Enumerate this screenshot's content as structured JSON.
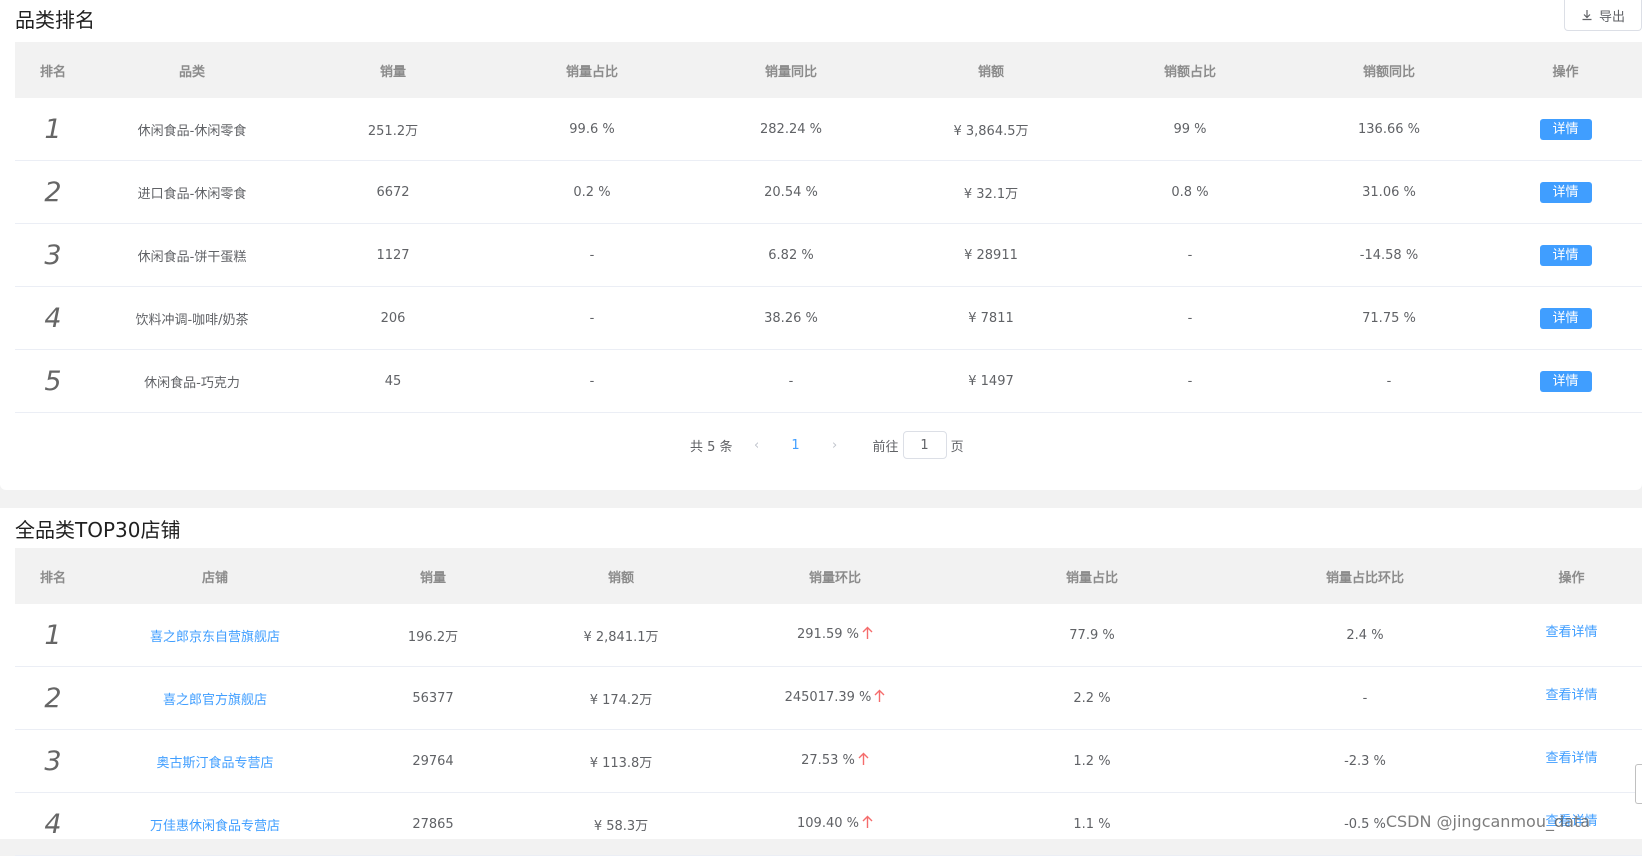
{
  "category_section": {
    "title": "品类排名",
    "export_label": "导出",
    "columns": [
      "排名",
      "品类",
      "销量",
      "销量占比",
      "销量同比",
      "销额",
      "销额占比",
      "销额同比",
      "操作"
    ],
    "detail_label": "详情",
    "rows": [
      {
        "rank": "1",
        "category": "休闲食品-休闲零食",
        "sales_qty": "251.2万",
        "qty_share": "99.6 %",
        "qty_yoy": "282.24 %",
        "amount": "¥ 3,864.5万",
        "amount_share": "99 %",
        "amount_yoy": "136.66 %"
      },
      {
        "rank": "2",
        "category": "进口食品-休闲零食",
        "sales_qty": "6672",
        "qty_share": "0.2 %",
        "qty_yoy": "20.54 %",
        "amount": "¥ 32.1万",
        "amount_share": "0.8 %",
        "amount_yoy": "31.06 %"
      },
      {
        "rank": "3",
        "category": "休闲食品-饼干蛋糕",
        "sales_qty": "1127",
        "qty_share": "-",
        "qty_yoy": "6.82 %",
        "amount": "¥ 28911",
        "amount_share": "-",
        "amount_yoy": "-14.58 %"
      },
      {
        "rank": "4",
        "category": "饮料冲调-咖啡/奶茶",
        "sales_qty": "206",
        "qty_share": "-",
        "qty_yoy": "38.26 %",
        "amount": "¥ 7811",
        "amount_share": "-",
        "amount_yoy": "71.75 %"
      },
      {
        "rank": "5",
        "category": "休闲食品-巧克力",
        "sales_qty": "45",
        "qty_share": "-",
        "qty_yoy": "-",
        "amount": "¥ 1497",
        "amount_share": "-",
        "amount_yoy": "-"
      }
    ],
    "pagination": {
      "total_text": "共 5 条",
      "current_page": "1",
      "goto_prefix": "前往",
      "goto_value": "1",
      "goto_suffix": "页"
    }
  },
  "store_section": {
    "title": "全品类TOP30店铺",
    "columns": [
      "排名",
      "店铺",
      "销量",
      "销额",
      "销量环比",
      "销量占比",
      "销量占比环比",
      "操作"
    ],
    "view_detail_label": "查看详情",
    "rows": [
      {
        "rank": "1",
        "store": "喜之郎京东自营旗舰店",
        "sales_qty": "196.2万",
        "amount": "¥ 2,841.1万",
        "qty_mom": "291.59 %",
        "qty_share": "77.9 %",
        "share_mom": "2.4 %"
      },
      {
        "rank": "2",
        "store": "喜之郎官方旗舰店",
        "sales_qty": "56377",
        "amount": "¥ 174.2万",
        "qty_mom": "245017.39 %",
        "qty_share": "2.2 %",
        "share_mom": "-"
      },
      {
        "rank": "3",
        "store": "奥古斯汀食品专营店",
        "sales_qty": "29764",
        "amount": "¥ 113.8万",
        "qty_mom": "27.53 %",
        "qty_share": "1.2 %",
        "share_mom": "-2.3 %"
      },
      {
        "rank": "4",
        "store": "万佳惠休闲食品专营店",
        "sales_qty": "27865",
        "amount": "¥ 58.3万",
        "qty_mom": "109.40 %",
        "qty_share": "1.1 %",
        "share_mom": "-0.5 %"
      }
    ]
  },
  "watermark": "CSDN @jingcanmou_data",
  "colors": {
    "primary": "#409eff",
    "up_arrow": "#f56c6c",
    "header_bg": "#f2f2f2"
  },
  "icons": {
    "export": "download-icon",
    "trend": "arrow-up-icon"
  }
}
